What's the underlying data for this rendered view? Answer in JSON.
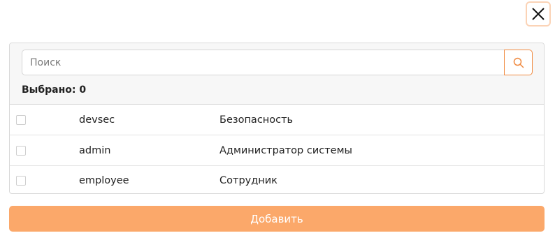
{
  "search": {
    "placeholder": "Поиск",
    "value": ""
  },
  "selection": {
    "label": "Выбрано: 0"
  },
  "rows": [
    {
      "code": "devsec",
      "title": "Безопасность",
      "checked": false
    },
    {
      "code": "admin",
      "title": "Администратор системы",
      "checked": false
    },
    {
      "code": "employee",
      "title": "Сотрудник",
      "checked": false
    }
  ],
  "actions": {
    "add_label": "Добавить"
  },
  "colors": {
    "accent": "#f08a40",
    "button_bg": "#fba86a",
    "close_border": "#fbd3b6"
  },
  "icons": {
    "close": "close-icon",
    "search": "search-icon"
  }
}
